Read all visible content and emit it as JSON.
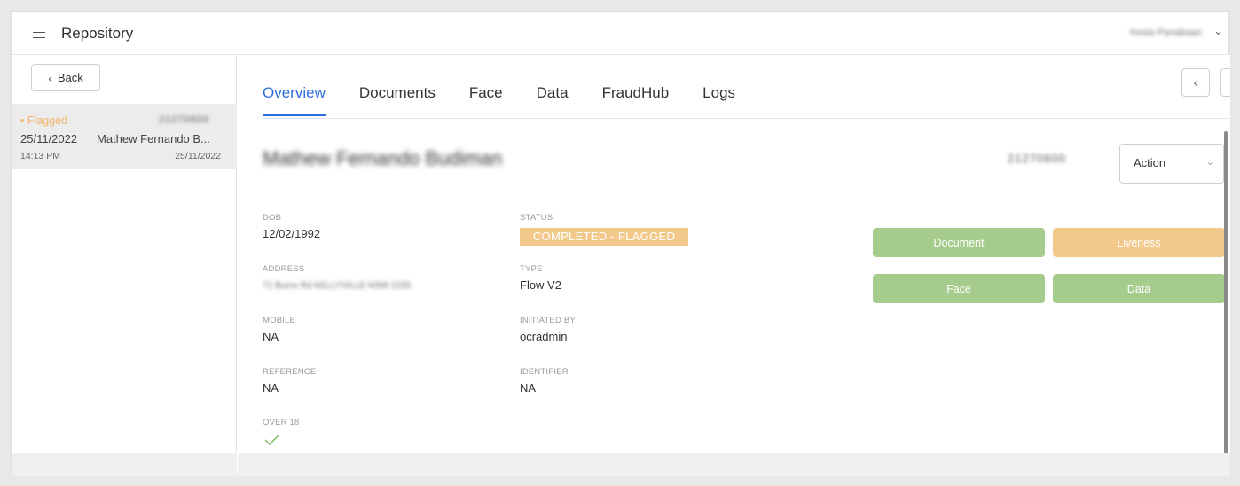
{
  "app": {
    "title": "Repository",
    "user_name": "Kesia Panabaan"
  },
  "left_panel": {
    "back_label": "Back",
    "items": [
      {
        "status": "• Flagged",
        "id": "21270600",
        "date": "25/11/2022",
        "name": "Mathew Fernando B...",
        "time": "14:13 PM",
        "date2": "25/11/2022"
      }
    ]
  },
  "tabs": [
    "Overview",
    "Documents",
    "Face",
    "Data",
    "FraudHub",
    "Logs"
  ],
  "active_tab": "Overview",
  "header": {
    "name": "Mathew Fernando Budiman",
    "id": "21270600",
    "action_label": "Action"
  },
  "fields": {
    "dob": {
      "label": "DOB",
      "value": "12/02/1992"
    },
    "address": {
      "label": "ADDRESS",
      "value": "71 Burns Rd KELLYVILLE NSW 2155"
    },
    "mobile": {
      "label": "MOBILE",
      "value": "NA"
    },
    "reference": {
      "label": "REFERENCE",
      "value": "NA"
    },
    "over18": {
      "label": "OVER 18"
    },
    "status": {
      "label": "STATUS",
      "value": "COMPLETED - FLAGGED"
    },
    "type": {
      "label": "TYPE",
      "value": "Flow V2"
    },
    "initiated_by": {
      "label": "INITIATED BY",
      "value": "ocradmin"
    },
    "identifier": {
      "label": "IDENTIFIER",
      "value": "NA"
    }
  },
  "check_buttons": {
    "document": {
      "label": "Document",
      "color": "#a5cc8d"
    },
    "liveness": {
      "label": "Liveness",
      "color": "#f2c98a"
    },
    "face": {
      "label": "Face",
      "color": "#a5cc8d"
    },
    "data": {
      "label": "Data",
      "color": "#a5cc8d"
    }
  },
  "colors": {
    "accent": "#2f6fdb",
    "flagged": "#f0b46a",
    "pass_green": "#a5cc8d",
    "warn_orange": "#f2c98a"
  },
  "icons": {
    "menu": "hamburger-icon",
    "back": "chevron-left-icon",
    "user_menu": "chevron-down-icon",
    "prev": "chevron-left-icon",
    "next": "chevron-right-icon",
    "over18": "check-icon"
  }
}
